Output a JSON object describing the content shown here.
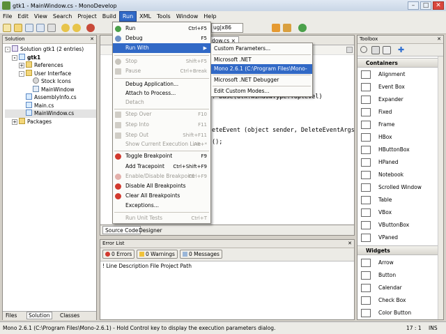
{
  "window": {
    "title": "gtk1 - MainWindow.cs - MonoDevelop",
    "controls": [
      "–",
      "□",
      "✕"
    ]
  },
  "menubar": {
    "items": [
      "File",
      "Edit",
      "View",
      "Search",
      "Project",
      "Build",
      "Run",
      "XML",
      "Tools",
      "Window",
      "Help"
    ],
    "active": "Run"
  },
  "toolbar": {
    "config_combo": "ug|x86"
  },
  "solution_panel": {
    "title": "Solution",
    "close": "✕",
    "items": [
      "Solution gtk1 (2 entries)",
      "gtk1",
      "References",
      "User Interface",
      "Stock Icons",
      "MainWindow",
      "AssemblyInfo.cs",
      "Main.cs",
      "MainWindow.cs",
      "Packages"
    ],
    "bottom_tabs": [
      "Files",
      "Solution",
      "Classes"
    ]
  },
  "editor": {
    "tab_label": "dow.cs",
    "close": "×",
    "code_lines": [
      ": base(Gtk.WindowType.Toplevel)",
      "eteEvent (object sender, DeleteEventArgs",
      "();"
    ],
    "bottom_tabs": [
      "Source Code",
      "Designer"
    ]
  },
  "run_menu": {
    "items": [
      {
        "label": "Run",
        "shortcut": "Ctrl+F5",
        "enabled": true
      },
      {
        "label": "Debug",
        "shortcut": "F5",
        "enabled": true
      },
      {
        "label": "Run With",
        "shortcut": "",
        "enabled": true,
        "submenu": true
      },
      {
        "label": "Stop",
        "shortcut": "Shift+F5",
        "enabled": false
      },
      {
        "label": "Pause",
        "shortcut": "Ctrl+Break",
        "enabled": false
      },
      {
        "label": "Debug Application...",
        "shortcut": "",
        "enabled": true
      },
      {
        "label": "Attach to Process...",
        "shortcut": "",
        "enabled": true
      },
      {
        "label": "Detach",
        "shortcut": "",
        "enabled": false
      },
      {
        "label": "Step Over",
        "shortcut": "F10",
        "enabled": false
      },
      {
        "label": "Step Into",
        "shortcut": "F11",
        "enabled": false
      },
      {
        "label": "Step Out",
        "shortcut": "Shift+F11",
        "enabled": false
      },
      {
        "label": "Show Current Execution Line",
        "shortcut": "Alt+*",
        "enabled": false
      },
      {
        "label": "Toggle Breakpoint",
        "shortcut": "F9",
        "enabled": true
      },
      {
        "label": "Add Tracepoint",
        "shortcut": "Ctrl+Shift+F9",
        "enabled": true
      },
      {
        "label": "Enable/Disable Breakpoint",
        "shortcut": "Ctrl+F9",
        "enabled": false
      },
      {
        "label": "Disable All Breakpoints",
        "shortcut": "",
        "enabled": true
      },
      {
        "label": "Clear All Breakpoints",
        "shortcut": "",
        "enabled": true
      },
      {
        "label": "Exceptions...",
        "shortcut": "",
        "enabled": true
      },
      {
        "label": "Run Unit Tests",
        "shortcut": "Ctrl+T",
        "enabled": false
      }
    ]
  },
  "run_with_submenu": {
    "items": [
      "Custom Parameters...",
      "Microsoft .NET",
      "Mono 2.6.1 (C:\\Program Files\\Mono-2.6.1)",
      "Microsoft .NET Debugger",
      "Edit Custom Modes..."
    ],
    "selected": "Mono 2.6.1 (C:\\Program Files\\Mono-2.6.1)"
  },
  "error_list": {
    "title": "Error List",
    "close": "✕",
    "buttons": [
      "0 Errors",
      "0 Warnings",
      "0 Messages"
    ],
    "columns": "! Line Description File Project Path"
  },
  "toolbox": {
    "title": "Toolbox",
    "close": "✕",
    "sections": [
      {
        "name": "Containers",
        "items": [
          "Alignment",
          "Event Box",
          "Expander",
          "Fixed",
          "Frame",
          "HBox",
          "HButtonBox",
          "HPaned",
          "Notebook",
          "Scrolled Window",
          "Table",
          "VBox",
          "VButtonBox",
          "VPaned"
        ]
      },
      {
        "name": "Widgets",
        "items": [
          "Arrow",
          "Button",
          "Calendar",
          "Check Box",
          "Color Button"
        ]
      }
    ]
  },
  "status_bar": {
    "message": "Mono 2.6.1 (C:\\Program Files\\Mono-2.6.1) - Hold Control key to display the execution parameters dialog.",
    "position": "17 : 1",
    "mode": "INS"
  },
  "colors": {
    "highlight": "#3169c6",
    "menubar": "#ecebe6",
    "titlebar": "#c9d6e6"
  }
}
